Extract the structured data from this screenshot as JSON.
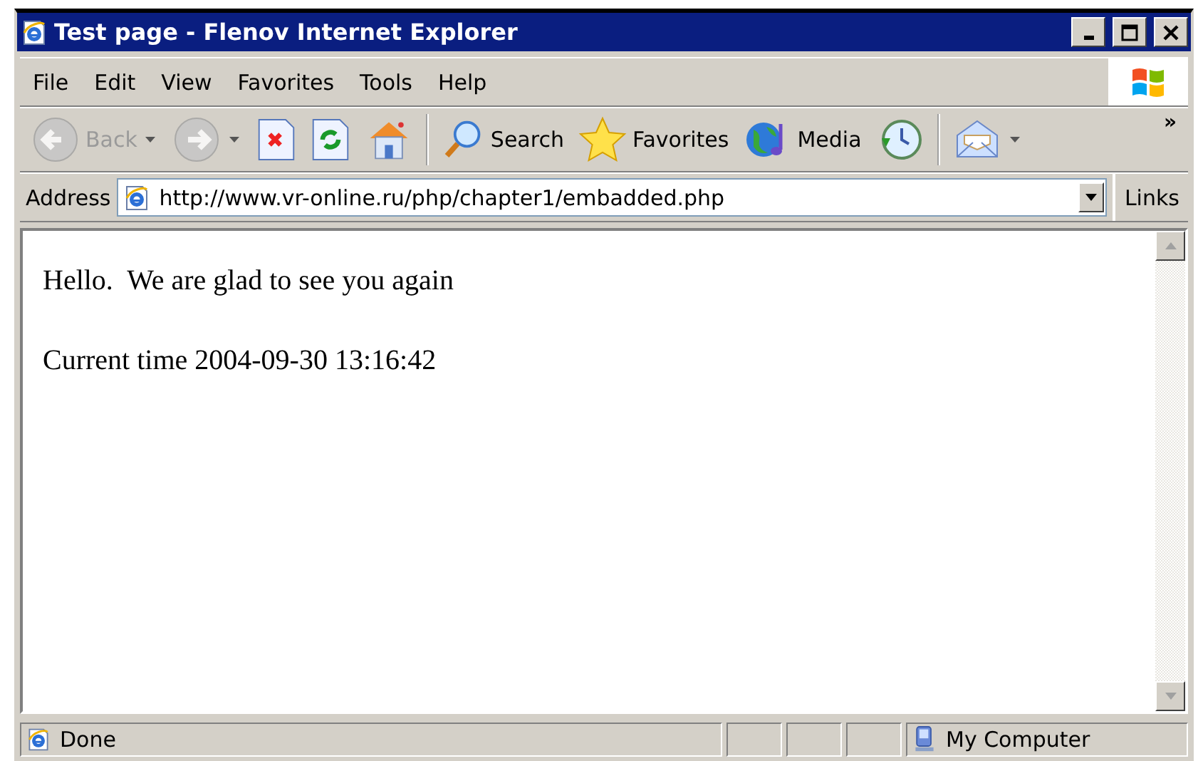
{
  "window": {
    "title": "Test page - Flenov Internet Explorer"
  },
  "menu": [
    "File",
    "Edit",
    "View",
    "Favorites",
    "Tools",
    "Help"
  ],
  "toolbar": [
    {
      "kind": "back",
      "label": "Back",
      "disabled": true,
      "dropdown": true
    },
    {
      "kind": "forward",
      "disabled": true,
      "dropdown": true
    },
    {
      "kind": "stop",
      "disabled": false
    },
    {
      "kind": "refresh",
      "disabled": false
    },
    {
      "kind": "home",
      "disabled": false
    },
    {
      "kind": "separator"
    },
    {
      "kind": "search",
      "label": "Search",
      "disabled": false
    },
    {
      "kind": "favorites",
      "label": "Favorites",
      "disabled": false
    },
    {
      "kind": "media",
      "label": "Media",
      "disabled": false
    },
    {
      "kind": "history",
      "disabled": false
    },
    {
      "kind": "separator"
    },
    {
      "kind": "mail",
      "disabled": false,
      "dropdown": true
    }
  ],
  "toolbar_overflow": "»",
  "address_bar": {
    "label": "Address",
    "value": "http://www.vr-online.ru/php/chapter1/embadded.php",
    "links": "Links"
  },
  "content": [
    "Hello.  We are glad to see you again",
    "Current time 2004-09-30 13:16:42"
  ],
  "status_bar": {
    "text": "Done",
    "zone": "My Computer"
  }
}
